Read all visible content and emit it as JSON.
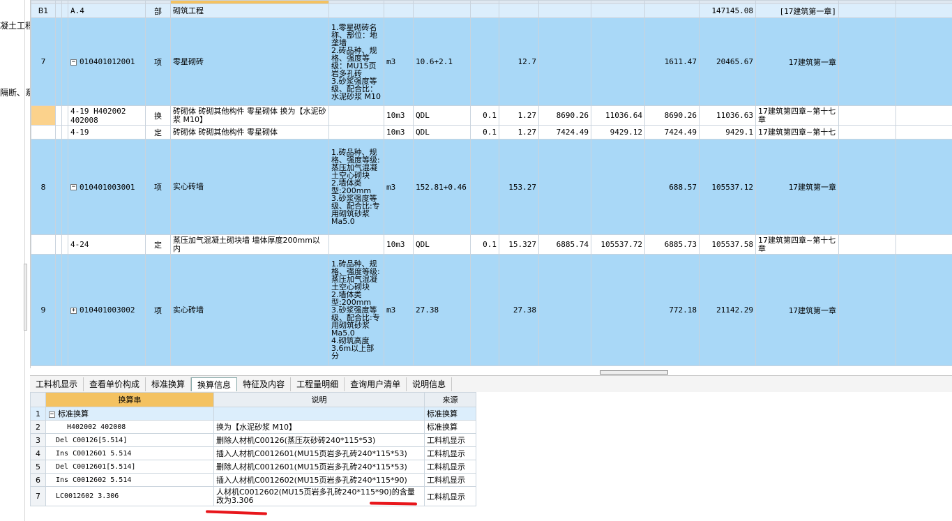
{
  "left_panel": {
    "fragments": [
      "凝土工程",
      "隔断、系"
    ]
  },
  "main_rows": [
    {
      "kind": "b1",
      "seq": "B1",
      "code": "A.4",
      "type": "部",
      "name": "砌筑工程",
      "features": "",
      "unit": "",
      "qty_expr": "",
      "content": "",
      "qty": "",
      "c1": "",
      "c2": "",
      "c3": "",
      "total": "147145.08",
      "chapter": "[17建筑第一章]"
    },
    {
      "kind": "sel",
      "seq": "7",
      "code": "010401012001",
      "toggle": "−",
      "type": "项",
      "name": "零星砌砖",
      "features": "1.零星砌砖名称、部位：地垄墙\n2.砖品种、规格、强度等级：MU15页岩多孔砖\n3.砂浆强度等级、配合比：水泥砂浆 M10",
      "unit": "m3",
      "qty_expr": "10.6+2.1",
      "content": "",
      "qty": "12.7",
      "c1": "",
      "c2": "",
      "c3": "1611.47",
      "total": "20465.67",
      "chapter": "17建筑第一章"
    },
    {
      "kind": "white",
      "seq": "",
      "code": "4-19 H402002 402008",
      "type": "换",
      "name": "砖砌体 砖砌其他构件 零星砌体 换为【水泥砂浆 M10】",
      "features": "",
      "unit": "10m3",
      "qty_expr": "QDL",
      "content": "0.1",
      "qty": "1.27",
      "c1": "8690.26",
      "c2": "11036.64",
      "c3": "8690.26",
      "total": "11036.63",
      "chapter": "17建筑第四章~第十七章"
    },
    {
      "kind": "white",
      "seq": "",
      "code": "4-19",
      "type": "定",
      "name": "砖砌体 砖砌其他构件 零星砌体",
      "features": "",
      "unit": "10m3",
      "qty_expr": "QDL",
      "content": "0.1",
      "qty": "1.27",
      "c1": "7424.49",
      "c2": "9429.12",
      "c3": "7424.49",
      "total": "9429.1",
      "chapter": "17建筑第四章~第十七"
    },
    {
      "kind": "sel",
      "seq": "8",
      "code": "010401003001",
      "toggle": "−",
      "type": "项",
      "name": "实心砖墙",
      "features": "1.砖品种、规格、强度等级:蒸压加气混凝土空心砌块\n2.墙体类型:200mm\n3.砂浆强度等级、配合比:专用砌筑砂浆 Ma5.0",
      "unit": "m3",
      "qty_expr": "152.81+0.46",
      "content": "",
      "qty": "153.27",
      "c1": "",
      "c2": "",
      "c3": "688.57",
      "total": "105537.12",
      "chapter": "17建筑第一章"
    },
    {
      "kind": "white",
      "seq": "",
      "code": "4-24",
      "type": "定",
      "name": "蒸压加气混凝土砌块墙 墙体厚度200mm以内",
      "features": "",
      "unit": "10m3",
      "qty_expr": "QDL",
      "content": "0.1",
      "qty": "15.327",
      "c1": "6885.74",
      "c2": "105537.72",
      "c3": "6885.73",
      "total": "105537.58",
      "chapter": "17建筑第四章~第十七章"
    },
    {
      "kind": "sel",
      "seq": "9",
      "code": "010401003002",
      "toggle": "+",
      "type": "项",
      "name": "实心砖墙",
      "features": "1.砖品种、规格、强度等级:蒸压加气混凝土空心砌块\n2.墙体类型:200mm\n3.砂浆强度等级、配合比:专用砌筑砂浆 Ma5.0\n4.砌筑高度3.6m以上部分",
      "unit": "m3",
      "qty_expr": "27.38",
      "content": "",
      "qty": "27.38",
      "c1": "",
      "c2": "",
      "c3": "772.18",
      "total": "21142.29",
      "chapter": "17建筑第一章"
    }
  ],
  "tabs": [
    "工料机显示",
    "查看单价构成",
    "标准换算",
    "换算信息",
    "特征及内容",
    "工程量明细",
    "查询用户清单",
    "说明信息"
  ],
  "active_tab": "换算信息",
  "detail": {
    "headers": {
      "expr": "换算串",
      "desc": "说明",
      "source": "来源"
    },
    "rows": [
      {
        "n": "1",
        "expr": "标准换算",
        "desc": "",
        "source": "标准换算",
        "group": true
      },
      {
        "n": "2",
        "expr": "H402002 402008",
        "desc": "换为【水泥砂浆 M10】",
        "source": "标准换算"
      },
      {
        "n": "3",
        "expr": "Del C00126[5.514]",
        "desc": "删除人材机C00126(蒸压灰砂砖240*115*53)",
        "source": "工料机显示"
      },
      {
        "n": "4",
        "expr": "Ins C0012601 5.514",
        "desc": "插入人材机C0012601(MU15页岩多孔砖240*115*53)",
        "source": "工料机显示"
      },
      {
        "n": "5",
        "expr": "Del C0012601[5.514]",
        "desc": "删除人材机C0012601(MU15页岩多孔砖240*115*53)",
        "source": "工料机显示"
      },
      {
        "n": "6",
        "expr": "Ins C0012602 5.514",
        "desc": "插入人材机C0012602(MU15页岩多孔砖240*115*90)",
        "source": "工料机显示"
      },
      {
        "n": "7",
        "expr": "LC0012602 3.306",
        "desc": "人材机C0012602(MU15页岩多孔砖240*115*90)的含量改为3.306",
        "source": "工料机显示"
      }
    ]
  },
  "colors": {
    "selected_row": "#a9d8f7",
    "header_highlight": "#f4c261",
    "annotation_red": "#e8161b"
  }
}
